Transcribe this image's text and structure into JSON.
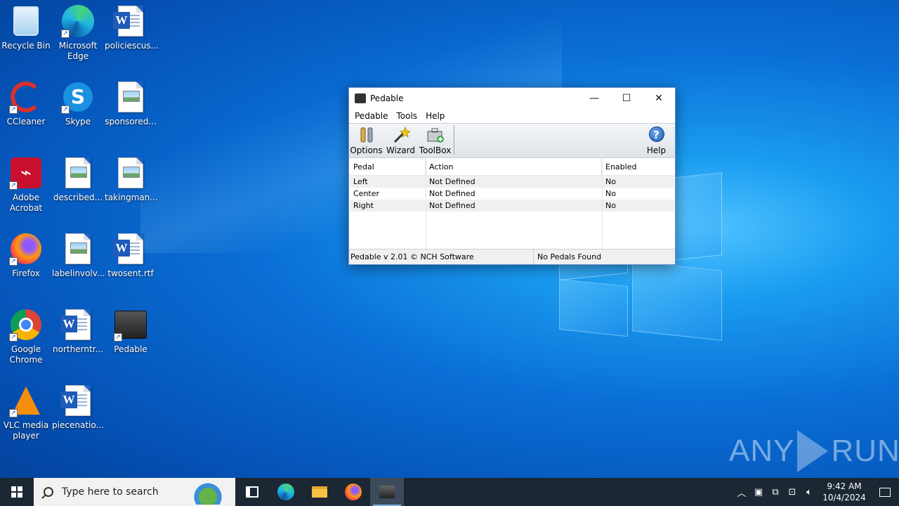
{
  "desktop": {
    "icons": [
      {
        "label": "Recycle Bin",
        "icon": "recycle-bin-icon"
      },
      {
        "label": "Microsoft Edge",
        "icon": "edge-icon"
      },
      {
        "label": "policiescus...",
        "icon": "word-doc-icon"
      },
      {
        "label": "CCleaner",
        "icon": "ccleaner-icon"
      },
      {
        "label": "Skype",
        "icon": "skype-icon"
      },
      {
        "label": "sponsored...",
        "icon": "image-doc-icon"
      },
      {
        "label": "Adobe Acrobat",
        "icon": "acrobat-icon"
      },
      {
        "label": "described...",
        "icon": "image-doc-icon"
      },
      {
        "label": "takingman...",
        "icon": "image-doc-icon"
      },
      {
        "label": "Firefox",
        "icon": "firefox-icon"
      },
      {
        "label": "labelinvolv...",
        "icon": "image-doc-icon"
      },
      {
        "label": "twosent.rtf",
        "icon": "word-doc-icon"
      },
      {
        "label": "Google Chrome",
        "icon": "chrome-icon"
      },
      {
        "label": "northerntr...",
        "icon": "word-doc-icon"
      },
      {
        "label": "Pedable",
        "icon": "pedable-icon"
      },
      {
        "label": "VLC media player",
        "icon": "vlc-icon"
      },
      {
        "label": "piecenatio...",
        "icon": "word-doc-icon"
      }
    ]
  },
  "window": {
    "title": "Pedable",
    "controls": {
      "minimize": "—",
      "maximize": "☐",
      "close": "✕"
    },
    "menu": [
      "Pedable",
      "Tools",
      "Help"
    ],
    "toolbar": {
      "options": "Options",
      "wizard": "Wizard",
      "toolbox": "ToolBox",
      "help": "Help"
    },
    "table": {
      "headers": [
        "Pedal",
        "Action",
        "Enabled"
      ],
      "rows": [
        [
          "Left",
          "Not Defined",
          "No"
        ],
        [
          "Center",
          "Not Defined",
          "No"
        ],
        [
          "Right",
          "Not Defined",
          "No"
        ]
      ]
    },
    "status": {
      "left": "Pedable v 2.01 © NCH Software",
      "right": "No Pedals Found"
    }
  },
  "watermark": {
    "left": "ANY",
    "right": "RUN"
  },
  "taskbar": {
    "search_placeholder": "Type here to search",
    "clock_time": "9:42 AM",
    "clock_date": "10/4/2024"
  }
}
